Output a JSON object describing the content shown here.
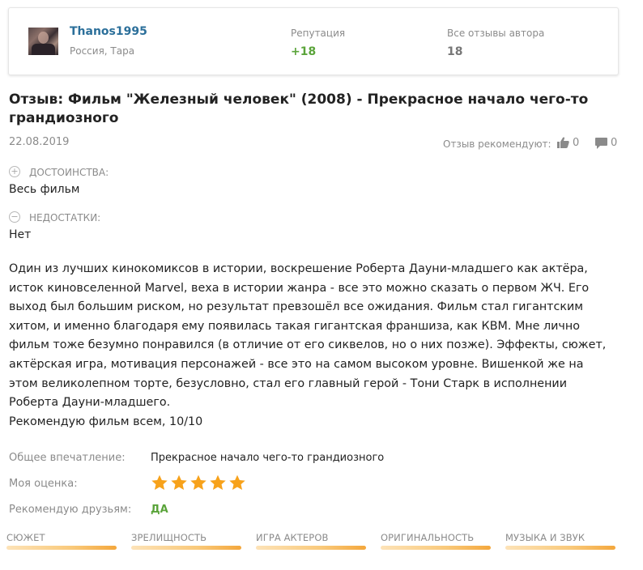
{
  "author": {
    "name": "Thanos1995",
    "location": "Россия, Тара",
    "reputation_label": "Репутация",
    "reputation_value": "+18",
    "all_reviews_label": "Все отзывы автора",
    "all_reviews_value": "18"
  },
  "review": {
    "title_line1": "Отзыв: Фильм \"Железный человек\" (2008) - Прекрасное начало чего-то",
    "title_line2": "грандиозного",
    "date": "22.08.2019",
    "recommend_label": "Отзыв рекомендуют:",
    "likes": "0",
    "comments": "0",
    "pros_label": "ДОСТОИНСТВА:",
    "pros_text": "Весь фильм",
    "cons_label": "НЕДОСТАТКИ:",
    "cons_text": "Нет",
    "body": [
      "Один из лучших кинокомиксов в истории, воскрешение Роберта Дауни-младшего как актёра,",
      "исток киновселенной Marvel, веха в истории жанра - все это можно сказать о первом ЖЧ. Его",
      "выход был большим риском, но результат превзошёл все ожидания. Фильм стал гигантским",
      "хитом, и именно благодаря ему появилась такая гигантская франшиза, как КВМ. Мне лично",
      "фильм тоже безумно понравился (в отличие от его сиквелов, но о них позже). Эффекты, сюжет,",
      "актёрская игра, мотивация персонажей - все это на самом высоком уровне. Вишенкой же на",
      "этом великолепном торте, безусловно, стал его главный герой - Тони Старк в исполнении",
      "Роберта Дауни-младшего.",
      "Рекомендую фильм всем, 10/10"
    ],
    "impression_label": "Общее впечатление:",
    "impression_value": "Прекрасное начало чего-то грандиозного",
    "score_label": "Моя оценка:",
    "score_stars": 5,
    "score_max": 5,
    "friends_label": "Рекомендую друзьям:",
    "friends_value": "ДА"
  },
  "criteria": [
    {
      "label": "СЮЖЕТ",
      "fill": 1.0
    },
    {
      "label": "ЗРЕЛИЩНОСТЬ",
      "fill": 1.0
    },
    {
      "label": "ИГРА АКТЕРОВ",
      "fill": 1.0
    },
    {
      "label": "ОРИГИНАЛЬНОСТЬ",
      "fill": 1.0
    },
    {
      "label": "МУЗЫКА И ЗВУК",
      "fill": 1.0
    }
  ],
  "icons": {
    "plus": "plus-circle-icon",
    "minus": "minus-circle-icon",
    "like": "thumbs-up-icon",
    "comment": "comment-icon",
    "star": "star-icon"
  },
  "colors": {
    "author_link": "#2b6f9a",
    "positive": "#5aa43a",
    "star": "#f7a21b",
    "criterion_bar": "#f4a73c"
  }
}
